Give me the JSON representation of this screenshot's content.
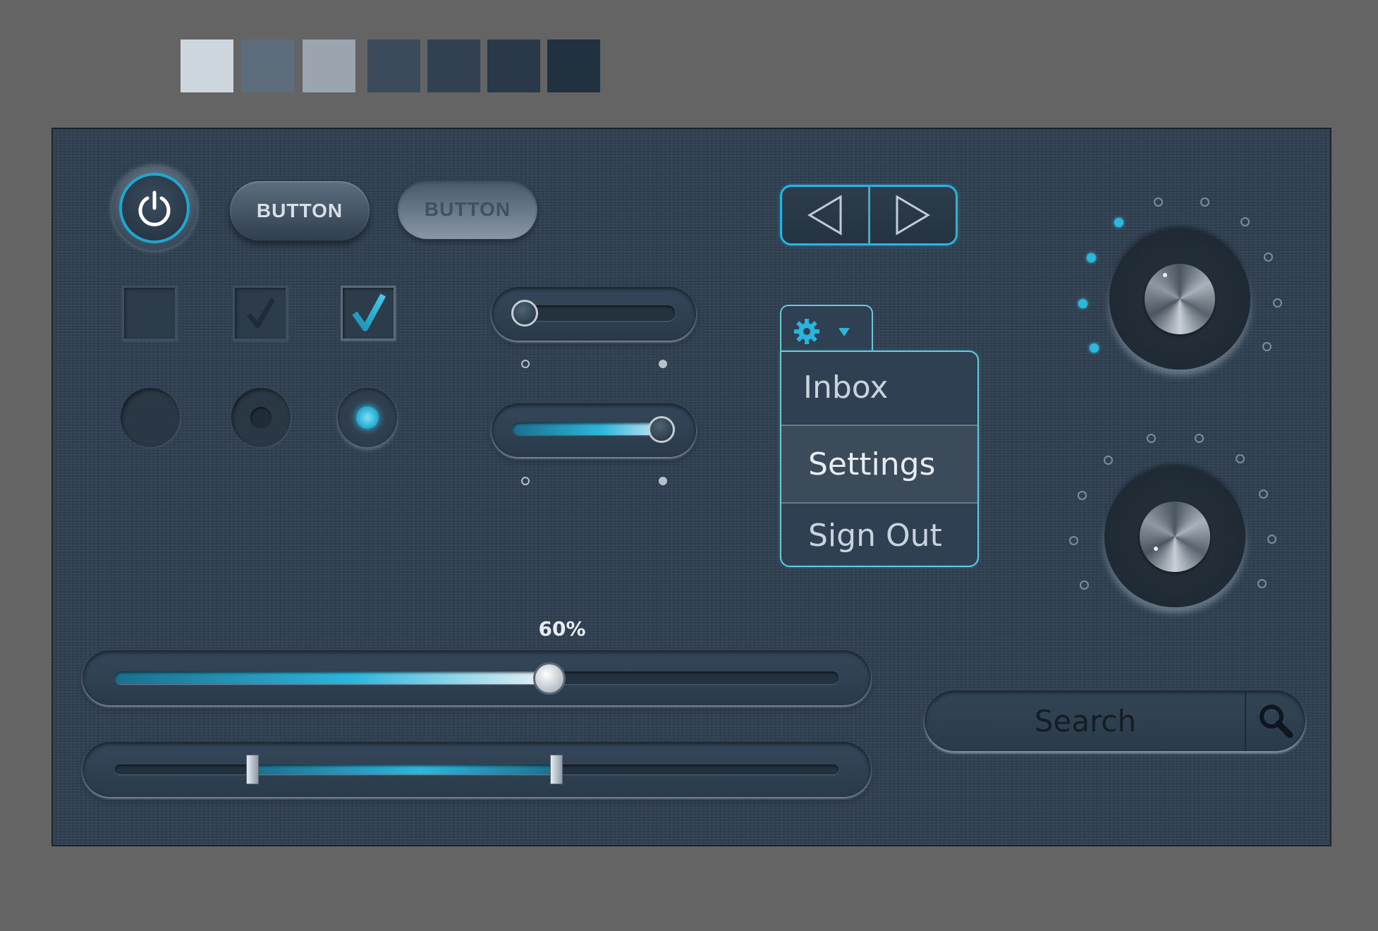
{
  "palette": {
    "swatches": [
      "#cdd5dd",
      "#5d6d7b",
      "#9ba5af",
      "#3b4b5c",
      "#314152",
      "#2a394a",
      "#213140"
    ]
  },
  "accent_color": "#28b4dc",
  "buttons": {
    "primary_label": "BUTTON",
    "disabled_label": "BUTTON"
  },
  "power_button": {
    "icon": "power-icon",
    "state": "on"
  },
  "checkboxes": [
    {
      "state": "unchecked"
    },
    {
      "state": "checked-inactive"
    },
    {
      "state": "checked-active"
    }
  ],
  "radios": [
    {
      "state": "off"
    },
    {
      "state": "selected-inactive"
    },
    {
      "state": "selected-active"
    }
  ],
  "toggle_sliders": [
    {
      "value": 0
    },
    {
      "value": 1
    }
  ],
  "nav_arrows": {
    "prev_icon": "triangle-left-icon",
    "next_icon": "triangle-right-icon"
  },
  "menu": {
    "trigger_icon": "gear-icon",
    "caret_icon": "caret-down-icon",
    "items": [
      "Inbox",
      "Settings",
      "Sign Out"
    ],
    "selected": "Settings"
  },
  "dials": [
    {
      "level_fraction": 0.3
    },
    {
      "level_fraction": 0.0
    }
  ],
  "progress_slider": {
    "label": "60%",
    "value": 0.6
  },
  "range_slider": {
    "low": 0.19,
    "high": 0.61
  },
  "search": {
    "placeholder": "Search",
    "icon": "magnifier-icon"
  }
}
